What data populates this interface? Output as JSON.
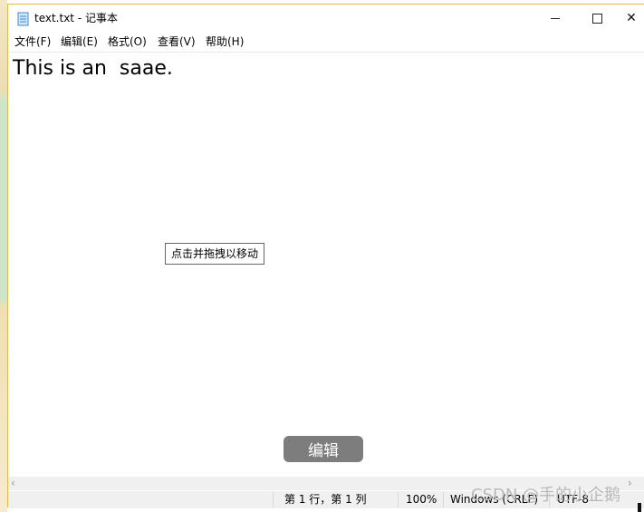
{
  "window": {
    "title": "text.txt - 记事本"
  },
  "menu": {
    "file": "文件(F)",
    "edit": "编辑(E)",
    "format": "格式(O)",
    "view": "查看(V)",
    "help": "帮助(H)"
  },
  "editor": {
    "text": "This is an  saae."
  },
  "tooltip": {
    "text": "点击并拖拽以移动"
  },
  "edit_button": {
    "label": "编辑"
  },
  "statusbar": {
    "position": "第 1 行，第 1 列",
    "zoom": "100%",
    "line_ending": "Windows (CRLF)",
    "encoding": "UTF-8"
  },
  "watermark": "CSDN @手的小企鹅"
}
